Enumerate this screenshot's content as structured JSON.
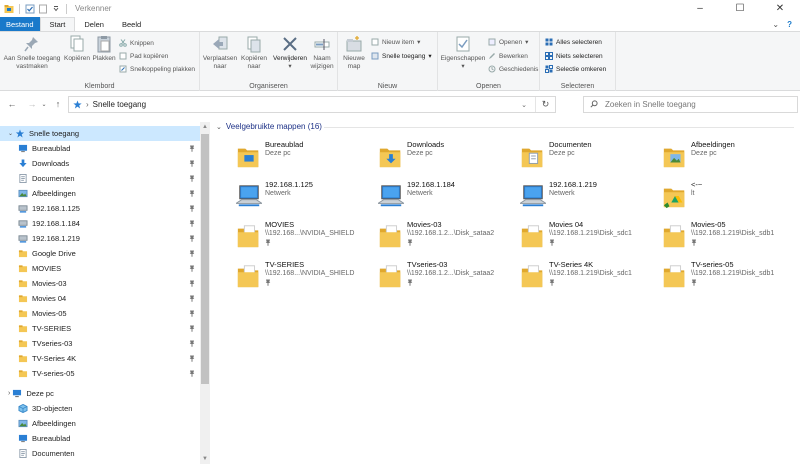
{
  "window": {
    "title": "Verkenner"
  },
  "tabs": {
    "file": "Bestand",
    "start": "Start",
    "share": "Delen",
    "view": "Beeld"
  },
  "ribbon": {
    "clipboard": {
      "label": "Klembord",
      "pin": [
        "Aan Snelle toegang",
        "vastmaken"
      ],
      "copy": "Kopiëren",
      "paste": "Plakken",
      "cut": "Knippen",
      "copy_path": "Pad kopiëren",
      "paste_shortcut": "Snelkoppeling plakken"
    },
    "organize": {
      "label": "Organiseren",
      "move": [
        "Verplaatsen",
        "naar"
      ],
      "copy_to": [
        "Kopiëren",
        "naar"
      ],
      "delete": "Verwijderen",
      "rename": [
        "Naam",
        "wijzigen"
      ]
    },
    "new": {
      "label": "Nieuw",
      "new_folder": [
        "Nieuwe",
        "map"
      ],
      "new_item": "Nieuw item",
      "easy_access": "Snelle toegang"
    },
    "open": {
      "label": "Openen",
      "properties": "Eigenschappen",
      "open": "Openen",
      "edit": "Bewerken",
      "history": "Geschiedenis"
    },
    "select": {
      "label": "Selecteren",
      "select_all": "Alles selecteren",
      "select_none": "Niets selecteren",
      "invert": "Selectie omkeren"
    }
  },
  "address": {
    "path": "Snelle toegang",
    "search_placeholder": "Zoeken in Snelle toegang"
  },
  "nav": {
    "quick_access": "Snelle toegang",
    "items": [
      {
        "label": "Bureaublad",
        "icon": "desktop-icon"
      },
      {
        "label": "Downloads",
        "icon": "download-icon"
      },
      {
        "label": "Documenten",
        "icon": "document-icon"
      },
      {
        "label": "Afbeeldingen",
        "icon": "picture-icon"
      },
      {
        "label": "192.168.1.125",
        "icon": "network-drive-icon"
      },
      {
        "label": "192.168.1.184",
        "icon": "network-drive-icon"
      },
      {
        "label": "192.168.1.219",
        "icon": "network-drive-icon"
      },
      {
        "label": "Google Drive",
        "icon": "folder-icon"
      },
      {
        "label": "MOVIES",
        "icon": "folder-icon"
      },
      {
        "label": "Movies-03",
        "icon": "folder-icon"
      },
      {
        "label": "Movies 04",
        "icon": "folder-icon"
      },
      {
        "label": "Movies-05",
        "icon": "folder-icon"
      },
      {
        "label": "TV-SERIES",
        "icon": "folder-icon"
      },
      {
        "label": "TVseries-03",
        "icon": "folder-icon"
      },
      {
        "label": "TV-Series 4K",
        "icon": "folder-icon"
      },
      {
        "label": "TV-series-05",
        "icon": "folder-icon"
      }
    ],
    "this_pc": "Deze pc",
    "pc_items": [
      {
        "label": "3D-objecten",
        "icon": "cube-icon"
      },
      {
        "label": "Afbeeldingen",
        "icon": "picture-icon"
      },
      {
        "label": "Bureaublad",
        "icon": "desktop-icon"
      },
      {
        "label": "Documenten",
        "icon": "document-icon"
      }
    ]
  },
  "content": {
    "section_title": "Veelgebruikte mappen (16)",
    "tiles": [
      {
        "name": "Bureaublad",
        "sub": "Deze pc",
        "icon": "desktop-folder-icon",
        "pinned": false
      },
      {
        "name": "Downloads",
        "sub": "Deze pc",
        "icon": "downloads-folder-icon",
        "pinned": false
      },
      {
        "name": "Documenten",
        "sub": "Deze pc",
        "icon": "documents-folder-icon",
        "pinned": false
      },
      {
        "name": "Afbeeldingen",
        "sub": "Deze pc",
        "icon": "pictures-folder-icon",
        "pinned": false
      },
      {
        "name": "192.168.1.125",
        "sub": "Netwerk",
        "icon": "network-computer-icon",
        "pinned": false
      },
      {
        "name": "192.168.1.184",
        "sub": "Netwerk",
        "icon": "network-computer-icon",
        "pinned": false
      },
      {
        "name": "192.168.1.219",
        "sub": "Netwerk",
        "icon": "network-computer-icon",
        "pinned": false
      },
      {
        "name": "<-~",
        "sub": "lt",
        "icon": "google-drive-folder-icon",
        "pinned": false
      },
      {
        "name": "MOVIES",
        "sub": "\\\\192.168...\\NVIDIA_SHIELD",
        "icon": "folder-icon",
        "pinned": true
      },
      {
        "name": "Movies-03",
        "sub": "\\\\192.168.1.2...\\Disk_sataa2",
        "icon": "folder-icon",
        "pinned": true
      },
      {
        "name": "Movies 04",
        "sub": "\\\\192.168.1.219\\Disk_sdc1",
        "icon": "folder-icon",
        "pinned": true
      },
      {
        "name": "Movies-05",
        "sub": "\\\\192.168.1.219\\Disk_sdb1",
        "icon": "folder-icon",
        "pinned": true
      },
      {
        "name": "TV-SERIES",
        "sub": "\\\\192.168...\\NVIDIA_SHIELD",
        "icon": "folder-icon",
        "pinned": true
      },
      {
        "name": "TVseries-03",
        "sub": "\\\\192.168.1.2...\\Disk_sataa2",
        "icon": "folder-icon",
        "pinned": true
      },
      {
        "name": "TV-Series 4K",
        "sub": "\\\\192.168.1.219\\Disk_sdc1",
        "icon": "folder-icon",
        "pinned": true
      },
      {
        "name": "TV-series-05",
        "sub": "\\\\192.168.1.219\\Disk_sdb1",
        "icon": "folder-icon",
        "pinned": true
      }
    ]
  },
  "colors": {
    "accent": "#1979ca",
    "selection": "#cce8ff",
    "folder": "#f4c755",
    "section_title": "#1e3287"
  }
}
